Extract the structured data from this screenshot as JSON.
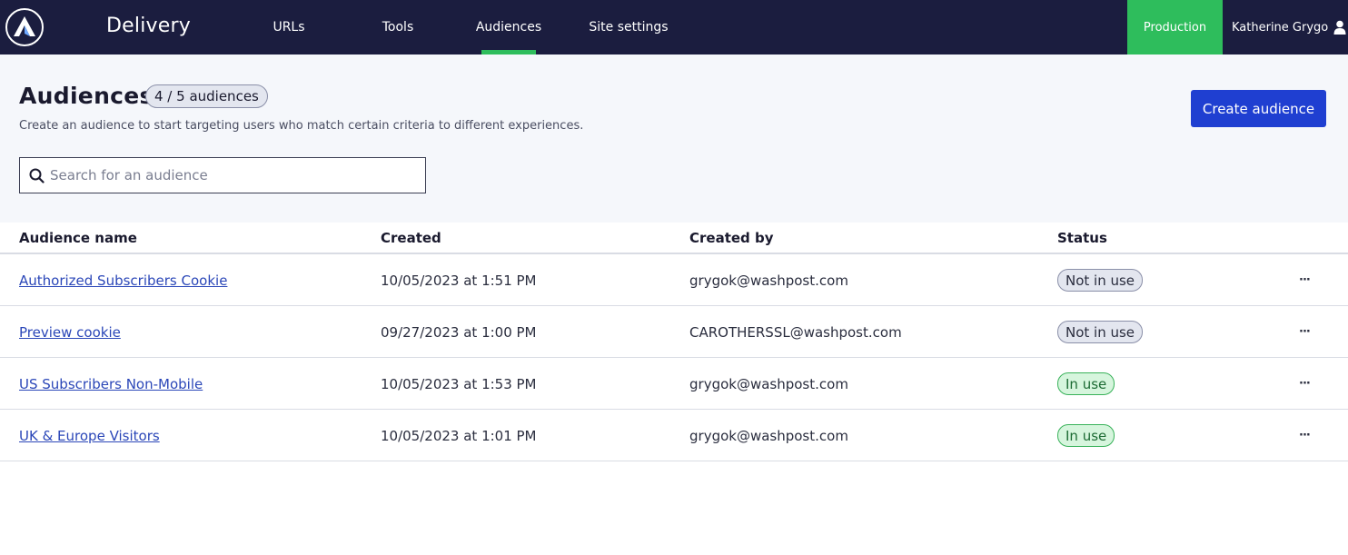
{
  "app": {
    "title": "Delivery",
    "logo_icon": "arrow-a-logo-icon"
  },
  "nav": {
    "items": [
      {
        "label": "URLs",
        "active": false
      },
      {
        "label": "Tools",
        "active": false
      },
      {
        "label": "Audiences",
        "active": true
      },
      {
        "label": "Site settings",
        "active": false
      }
    ],
    "environment": "Production",
    "user_name": "Katherine Grygo",
    "user_icon": "person-icon"
  },
  "page": {
    "title": "Audiences",
    "count_badge": "4 / 5 audiences",
    "description": "Create an audience to start targeting users who match certain criteria to different experiences.",
    "create_button": "Create audience"
  },
  "search": {
    "placeholder": "Search for an audience",
    "value": "",
    "icon": "search-icon"
  },
  "table": {
    "headers": [
      "Audience name",
      "Created",
      "Created by",
      "Status"
    ],
    "rows": [
      {
        "name": "Authorized Subscribers Cookie",
        "created": "10/05/2023 at 1:51 PM",
        "created_by": "grygok@washpost.com",
        "status": "Not in use",
        "more": "···"
      },
      {
        "name": "Preview cookie",
        "created": "09/27/2023 at 1:00 PM",
        "created_by": "CAROTHERSSL@washpost.com",
        "status": "Not in use",
        "more": "···"
      },
      {
        "name": "US Subscribers Non-Mobile",
        "created": "10/05/2023 at 1:53 PM",
        "created_by": "grygok@washpost.com",
        "status": "In use",
        "more": "···"
      },
      {
        "name": "UK & Europe Visitors",
        "created": "10/05/2023 at 1:01 PM",
        "created_by": "grygok@washpost.com",
        "status": "In use",
        "more": "···"
      }
    ]
  },
  "colors": {
    "nav_bg": "#1b1d3f",
    "accent_green": "#2ebd5c",
    "primary_button": "#1f3fd1",
    "header_bg": "#f5f7fb"
  }
}
